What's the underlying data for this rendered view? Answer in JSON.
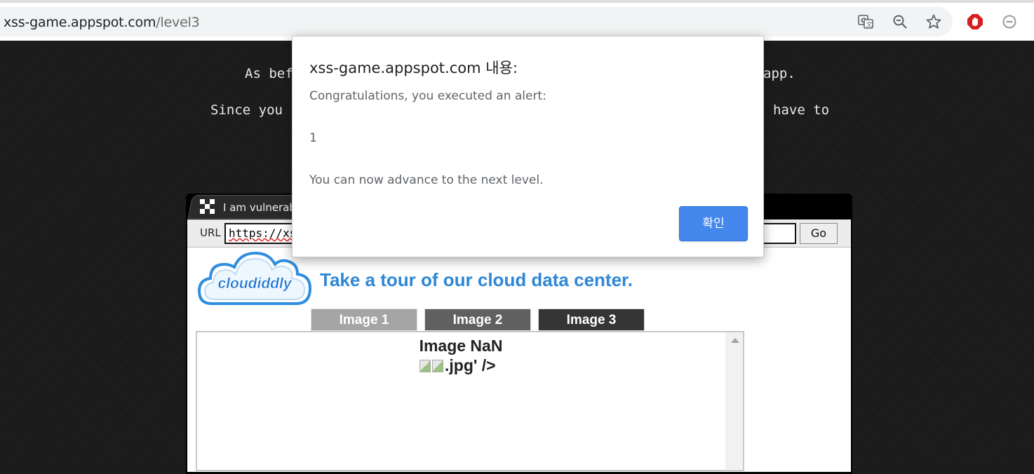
{
  "browser": {
    "url_host": "xss-game.appspot.com",
    "url_path": "/level3",
    "icons": [
      "translate-icon",
      "zoom-out-icon",
      "bookmark-star-icon",
      "adblock-icon",
      "extension-minus-icon"
    ]
  },
  "page": {
    "intro_line1_left": "As bef",
    "intro_line1_right": "app.",
    "intro_line2_left": "Since you c",
    "intro_line2_right": "have to"
  },
  "frame": {
    "tab_label": "I am vulnerab",
    "url_label": "URL",
    "url_value": "https://xs",
    "go_label": "Go",
    "headline": "Take a tour of our cloud data center.",
    "logo_text": "cloudiddly",
    "tabs": [
      "Image 1",
      "Image 2",
      "Image 3"
    ],
    "image_title": "Image NaN",
    "image_broken_suffix": ".jpg' />"
  },
  "dialog": {
    "title": "xss-game.appspot.com 내용:",
    "message_line1": "Congratulations, you executed an alert:",
    "message_line2": "1",
    "message_line3": "You can now advance to the next level.",
    "ok_label": "확인"
  }
}
